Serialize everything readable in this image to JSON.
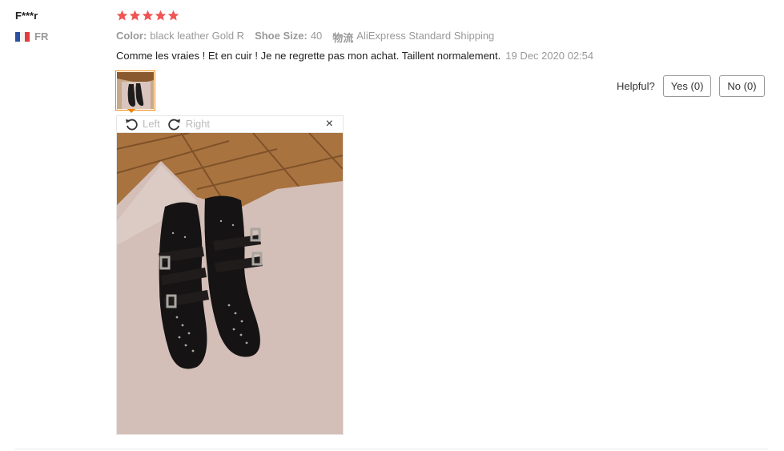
{
  "reviewer": {
    "name": "F***r",
    "country_code": "FR"
  },
  "rating": {
    "stars": 5,
    "star_color": "#f05454"
  },
  "attributes": [
    {
      "key": "Color:",
      "value": "black leather Gold R"
    },
    {
      "key": "Shoe Size:",
      "value": "40"
    },
    {
      "key": "物流",
      "value": "AliExpress Standard Shipping"
    }
  ],
  "review": {
    "text": "Comme les vraies ! Et en cuir ! Je ne regrette pas mon achat. Taillent normalement.",
    "date": "19 Dec 2020 02:54"
  },
  "helpful": {
    "label": "Helpful?",
    "yes_label": "Yes (0)",
    "no_label": "No (0)"
  },
  "viewer": {
    "rotate_left": "Left",
    "rotate_right": "Right",
    "close": "×"
  },
  "colors": {
    "accent_border": "#f08200",
    "muted_text": "#999999"
  }
}
